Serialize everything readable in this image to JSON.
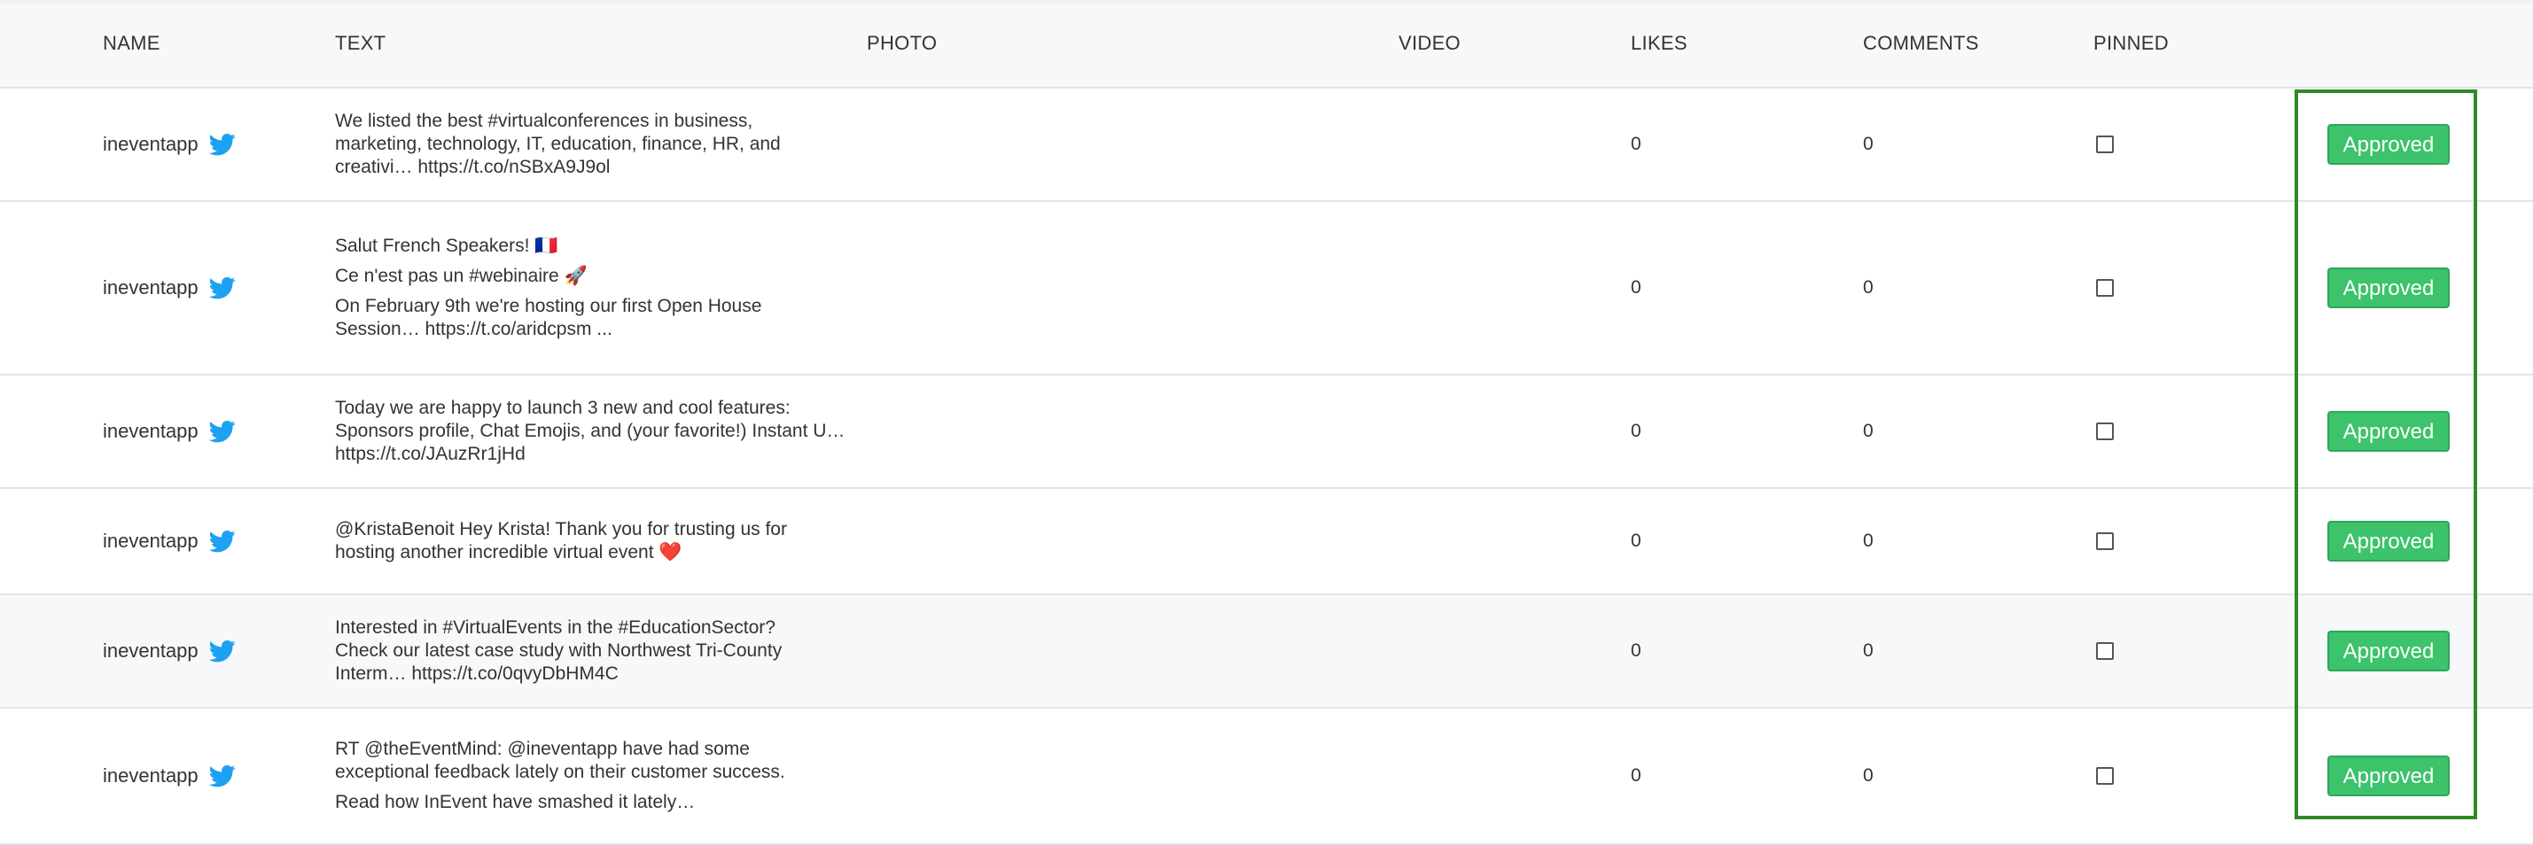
{
  "columns": {
    "name": "NAME",
    "text": "TEXT",
    "photo": "PHOTO",
    "video": "VIDEO",
    "likes": "LIKES",
    "comments": "COMMENTS",
    "pinned": "PINNED"
  },
  "rows": [
    {
      "name": "ineventapp",
      "icon": "twitter-icon",
      "text": [
        "We listed the best #virtualconferences in business,\nmarketing, technology, IT, education, finance, HR, and\ncreativi… https://t.co/nSBxA9J9ol"
      ],
      "likes": "0",
      "comments": "0",
      "pinned": false,
      "status": "Approved"
    },
    {
      "name": "ineventapp",
      "icon": "twitter-icon",
      "text": [
        "Salut French Speakers! 🇫🇷",
        "Ce n'est pas un #webinaire 🚀",
        "On February 9th we're hosting our first Open House\nSession… https://t.co/aridcpsm ..."
      ],
      "likes": "0",
      "comments": "0",
      "pinned": false,
      "status": "Approved"
    },
    {
      "name": "ineventapp",
      "icon": "twitter-icon",
      "text": [
        "Today we are happy to launch 3 new and cool features:\nSponsors profile, Chat Emojis, and (your favorite!) Instant U…\nhttps://t.co/JAuzRr1jHd"
      ],
      "likes": "0",
      "comments": "0",
      "pinned": false,
      "status": "Approved"
    },
    {
      "name": "ineventapp",
      "icon": "twitter-icon",
      "text": [
        "@KristaBenoit Hey Krista! Thank you for trusting us for\nhosting another incredible virtual event ❤️"
      ],
      "likes": "0",
      "comments": "0",
      "pinned": false,
      "status": "Approved"
    },
    {
      "name": "ineventapp",
      "icon": "twitter-icon",
      "text": [
        "Interested in #VirtualEvents in the #EducationSector?\nCheck our latest case study with Northwest Tri-County\nInterm… https://t.co/0qvyDbHM4C"
      ],
      "likes": "0",
      "comments": "0",
      "pinned": false,
      "status": "Approved"
    },
    {
      "name": "ineventapp",
      "icon": "twitter-icon",
      "text": [
        "RT @theEventMind: @ineventapp have had some\nexceptional feedback lately on their customer success.",
        "Read how InEvent have smashed it lately…"
      ],
      "likes": "0",
      "comments": "0",
      "pinned": false,
      "status": "Approved"
    }
  ],
  "colors": {
    "approved_button": "#3cc36b",
    "highlight_border": "#2e8b23",
    "twitter_blue": "#1da1f2"
  }
}
